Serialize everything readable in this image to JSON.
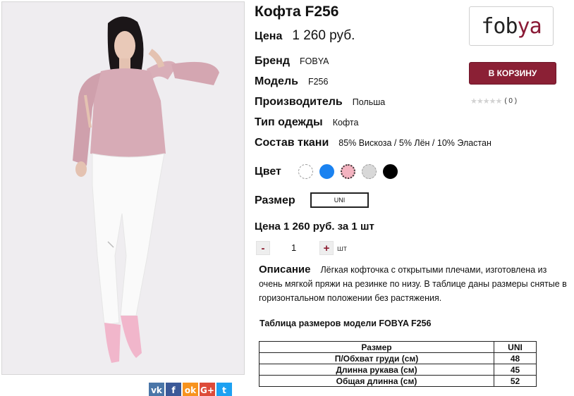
{
  "product": {
    "title": "Кофта F256",
    "price_label": "Цена",
    "price_value": "1 260 руб."
  },
  "properties": [
    {
      "label": "Бренд",
      "value": "FOBYA"
    },
    {
      "label": "Модель",
      "value": "F256"
    },
    {
      "label": "Производитель",
      "value": "Польша"
    },
    {
      "label": "Тип одежды",
      "value": "Кофта"
    },
    {
      "label": "Состав ткани",
      "value": "85% Вискоза / 5% Лён / 10% Эластан"
    }
  ],
  "colors": {
    "label": "Цвет",
    "swatches": [
      "#ffffff",
      "#1a82f0",
      "#f3b3c0",
      "#d8d8d8",
      "#000000"
    ],
    "selected": "#f3b3c0"
  },
  "size": {
    "label": "Размер",
    "value": "UNI"
  },
  "unit_price": "Цена 1 260 руб. за 1 шт",
  "quantity": {
    "minus": "-",
    "value": "1",
    "plus": "+",
    "unit": "шт"
  },
  "description": {
    "label": "Описание",
    "text": "Лёгкая кофточка с открытыми плечами, изготовлена из очень мягкой пряжи на резинке по низу. В таблице даны размеры снятые в горизонтальном положении без растяжения."
  },
  "size_table": {
    "title": "Таблица размеров модели FOBYA F256",
    "header": [
      "Размер",
      "UNI"
    ],
    "rows": [
      [
        "П/Обхват груди (см)",
        "48"
      ],
      [
        "Длинна рукава (см)",
        "45"
      ],
      [
        "Общая длинна (см)",
        "52"
      ]
    ]
  },
  "brand_logo": {
    "part1": "fob",
    "part2": "ya",
    "part3": ""
  },
  "cart_button": "В КОРЗИНУ",
  "rating": {
    "stars": "★★★★★",
    "count": "( 0 )"
  },
  "share": [
    {
      "icon": "vk-icon",
      "glyph": "vk",
      "color": "#4a76a8"
    },
    {
      "icon": "facebook-icon",
      "glyph": "f",
      "color": "#3b5998"
    },
    {
      "icon": "odnoklassniki-icon",
      "glyph": "ok",
      "color": "#f7931e"
    },
    {
      "icon": "google-plus-icon",
      "glyph": "G+",
      "color": "#dd4b39"
    },
    {
      "icon": "twitter-icon",
      "glyph": "t",
      "color": "#1da1f2"
    }
  ]
}
